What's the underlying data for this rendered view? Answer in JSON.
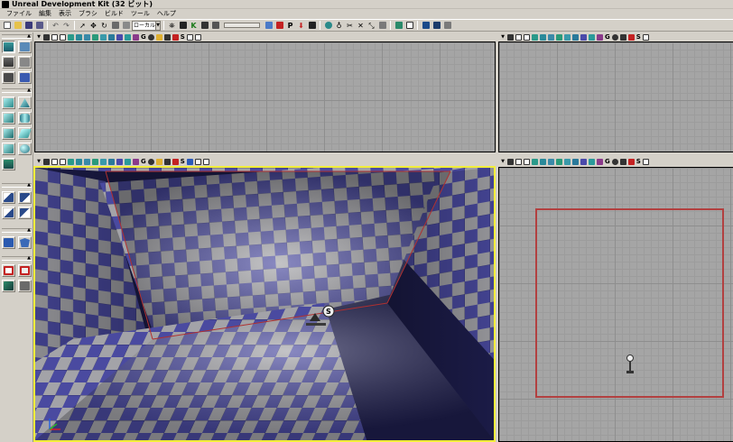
{
  "window": {
    "title": "Unreal Development Kit (32 ビット)"
  },
  "menu": {
    "items": [
      "ファイル",
      "編集",
      "表示",
      "ブラシ",
      "ビルド",
      "ツール",
      "ヘルプ"
    ]
  },
  "toolbar": {
    "coordinate_system_value": "ローカル",
    "kismet_label": "K"
  },
  "viewport_bar": {
    "g_label": "G",
    "s_label": "S"
  },
  "colors": {
    "chrome": "#d4d0c8",
    "ortho_bg": "#a5a5a5",
    "active_viewport_border": "#f2ee3a",
    "brush_outline": "#b24040",
    "checker_blue": "#4a4aa0",
    "checker_gray": "#a3a3a8"
  },
  "icons": {
    "player_start": "player-start-icon",
    "axis": "axis-gizmo-icon"
  }
}
